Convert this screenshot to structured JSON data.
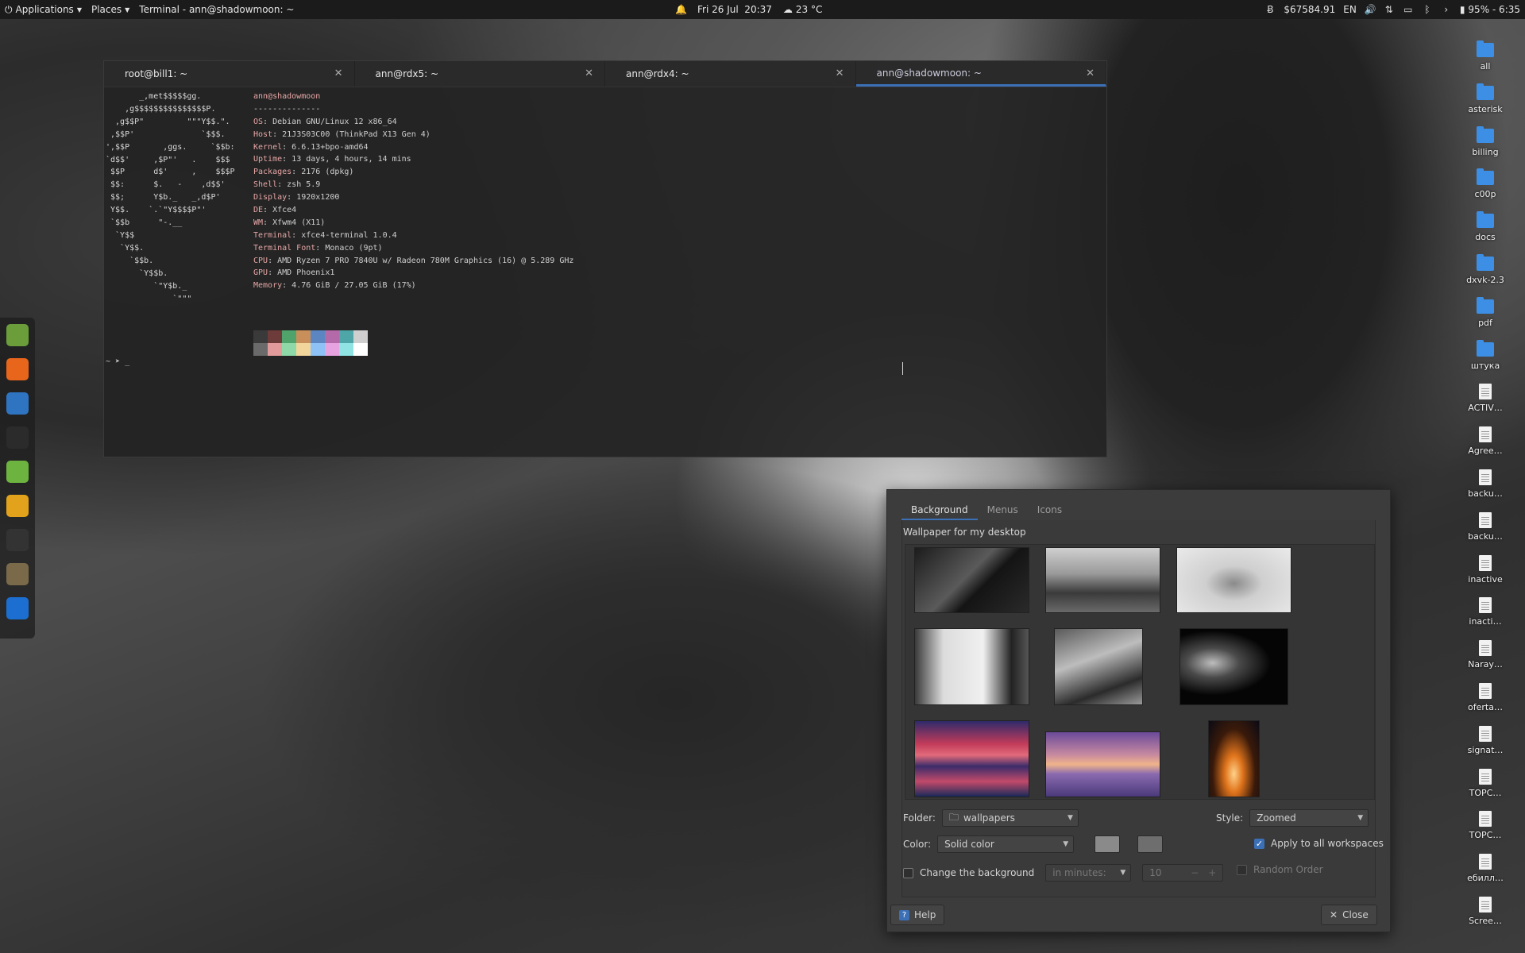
{
  "panel": {
    "applications": "Applications",
    "places": "Places",
    "window_title": "Terminal - ann@shadowmoon: ~",
    "datetime": "Fri 26 Jul  20:37",
    "weather": "23 °C",
    "balance": "$67584.91",
    "lang": "EN",
    "battery": "95% - 6:35"
  },
  "terminal": {
    "tabs": [
      {
        "label": "root@bill1: ~"
      },
      {
        "label": "ann@rdx5: ~"
      },
      {
        "label": "ann@rdx4: ~"
      },
      {
        "label": "ann@shadowmoon: ~"
      }
    ],
    "logo": "       _,met$$$$$gg.\n    ,g$$$$$$$$$$$$$$$P.\n  ,g$$P\"         \"\"\"Y$$.\".\n ,$$P'              `$$$.\n',$$P       ,ggs.     `$$b:\n`d$$'     ,$P\"'   .    $$$\n $$P      d$'     ,    $$$P\n $$:      $.   -    ,d$$'\n $$;      Y$b._   _,d$P'\n Y$$.    `.`\"Y$$$$P\"'\n `$$b      \"-.__\n  `Y$$\n   `Y$$.\n     `$$b.\n       `Y$$b.\n          `\"Y$b._\n              `\"\"\"",
    "user_host": "ann@shadowmoon",
    "separator": "--------------",
    "info": [
      {
        "k": "OS",
        "v": "Debian GNU/Linux 12 x86_64"
      },
      {
        "k": "Host",
        "v": "21J3S03C00 (ThinkPad X13 Gen 4)"
      },
      {
        "k": "Kernel",
        "v": "6.6.13+bpo-amd64"
      },
      {
        "k": "Uptime",
        "v": "13 days, 4 hours, 14 mins"
      },
      {
        "k": "Packages",
        "v": "2176 (dpkg)"
      },
      {
        "k": "Shell",
        "v": "zsh 5.9"
      },
      {
        "k": "Display",
        "v": "1920x1200"
      },
      {
        "k": "DE",
        "v": "Xfce4"
      },
      {
        "k": "WM",
        "v": "Xfwm4 (X11)"
      },
      {
        "k": "Terminal",
        "v": "xfce4-terminal 1.0.4"
      },
      {
        "k": "Terminal Font",
        "v": "Monaco (9pt)"
      },
      {
        "k": "CPU",
        "v": "AMD Ryzen 7 PRO 7840U w/ Radeon 780M Graphics (16) @ 5.289 GHz"
      },
      {
        "k": "GPU",
        "v": "AMD Phoenix1"
      },
      {
        "k": "Memory",
        "v": "4.76 GiB / 27.05 GiB (17%)"
      }
    ],
    "palette_top": [
      "#3a3a3a",
      "#6e3b3b",
      "#4fa36b",
      "#c98f5a",
      "#5b86c2",
      "#b46aa8",
      "#4ea6a8",
      "#cfcfcf"
    ],
    "palette_bottom": [
      "#6a6a6a",
      "#e39a9a",
      "#8fd9a8",
      "#f2d59a",
      "#8ec1f5",
      "#e7a3e0",
      "#8fe3e3",
      "#ffffff"
    ],
    "prompt": "~ ➤ _"
  },
  "dock": [
    {
      "name": "files",
      "color": "#6b9d3b"
    },
    {
      "name": "firefox",
      "color": "#e8651c"
    },
    {
      "name": "thunderbird",
      "color": "#2f74c0"
    },
    {
      "name": "terminal",
      "color": "#2b2b2b"
    },
    {
      "name": "contacts",
      "color": "#6db33f"
    },
    {
      "name": "chat",
      "color": "#e2a21b"
    },
    {
      "name": "amazon",
      "color": "#333333"
    },
    {
      "name": "gimp",
      "color": "#7a6a4a"
    },
    {
      "name": "desktop",
      "color": "#1c6fd1"
    }
  ],
  "desktop_icons": [
    {
      "label": "all",
      "type": "folder"
    },
    {
      "label": "asterisk",
      "type": "folder"
    },
    {
      "label": "billing",
      "type": "folder"
    },
    {
      "label": "c00p",
      "type": "folder"
    },
    {
      "label": "docs",
      "type": "folder"
    },
    {
      "label": "dxvk-2.3",
      "type": "folder"
    },
    {
      "label": "pdf",
      "type": "folder"
    },
    {
      "label": "штука",
      "type": "folder"
    },
    {
      "label": "ACTIV…",
      "type": "doc"
    },
    {
      "label": "Agree…",
      "type": "doc"
    },
    {
      "label": "backu…",
      "type": "doc"
    },
    {
      "label": "backu…",
      "type": "doc"
    },
    {
      "label": "inactive",
      "type": "doc"
    },
    {
      "label": "inacti…",
      "type": "doc"
    },
    {
      "label": "Naray…",
      "type": "doc"
    },
    {
      "label": "oferta…",
      "type": "doc"
    },
    {
      "label": "signat…",
      "type": "doc"
    },
    {
      "label": "TOPC…",
      "type": "doc"
    },
    {
      "label": "TOPC…",
      "type": "doc"
    },
    {
      "label": "ебилл…",
      "type": "doc"
    },
    {
      "label": "Scree…",
      "type": "doc"
    }
  ],
  "dialog": {
    "tabs": [
      "Background",
      "Menus",
      "Icons"
    ],
    "wallpaper_label": "Wallpaper for my desktop",
    "folder_label": "Folder:",
    "folder_value": "wallpapers",
    "style_label": "Style:",
    "style_value": "Zoomed",
    "color_label": "Color:",
    "color_value": "Solid color",
    "apply_all": "Apply to all workspaces",
    "change_bg": "Change the background",
    "interval_value": "in minutes:",
    "interval_number": "10",
    "random_order": "Random Order",
    "help": "Help",
    "close": "Close"
  }
}
